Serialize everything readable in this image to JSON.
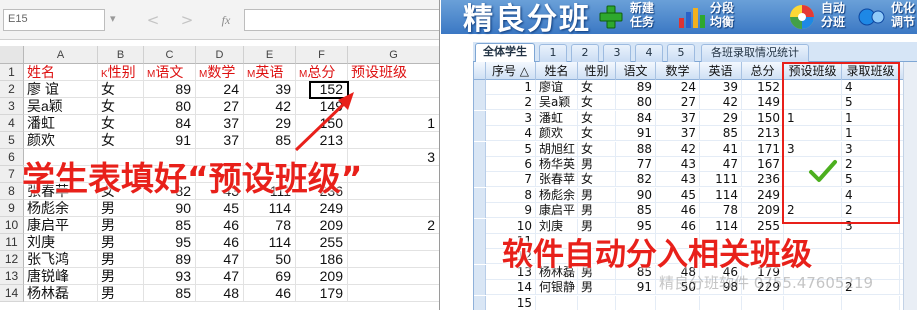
{
  "spreadsheet": {
    "name_box": "E15",
    "fx_label": "fx",
    "nav_left": "<",
    "nav_right": ">",
    "columns": [
      "A",
      "B",
      "C",
      "D",
      "E",
      "F",
      "G"
    ],
    "header_row": {
      "row_no": "1",
      "cells": [
        {
          "marker": "",
          "text": "姓名"
        },
        {
          "marker": "K",
          "text": "性别"
        },
        {
          "marker": "M",
          "text": "语文"
        },
        {
          "marker": "M",
          "text": "数学"
        },
        {
          "marker": "M",
          "text": "英语"
        },
        {
          "marker": "M",
          "text": "总分"
        },
        {
          "marker": "",
          "text": "预设班级"
        }
      ]
    },
    "rows": [
      {
        "no": "2",
        "name": "廖 谊",
        "gender": "女",
        "chinese": "89",
        "math": "24",
        "english": "39",
        "total": "152",
        "preset": ""
      },
      {
        "no": "3",
        "name": "吴a颖",
        "gender": "女",
        "chinese": "80",
        "math": "27",
        "english": "42",
        "total": "149",
        "preset": ""
      },
      {
        "no": "4",
        "name": "潘虹",
        "gender": "女",
        "chinese": "84",
        "math": "37",
        "english": "29",
        "total": "150",
        "preset": "1"
      },
      {
        "no": "5",
        "name": "颜欢",
        "gender": "女",
        "chinese": "91",
        "math": "37",
        "english": "85",
        "total": "213",
        "preset": ""
      },
      {
        "no": "6",
        "name": "",
        "gender": "",
        "chinese": "",
        "math": "",
        "english": "",
        "total": "",
        "preset": "3"
      },
      {
        "no": "7",
        "name": "",
        "gender": "",
        "chinese": "",
        "math": "",
        "english": "",
        "total": "",
        "preset": ""
      },
      {
        "no": "8",
        "name": "张春苹",
        "gender": "女",
        "chinese": "82",
        "math": "43",
        "english": "111",
        "total": "236",
        "preset": ""
      },
      {
        "no": "9",
        "name": "杨彪余",
        "gender": "男",
        "chinese": "90",
        "math": "45",
        "english": "114",
        "total": "249",
        "preset": ""
      },
      {
        "no": "10",
        "name": "康启平",
        "gender": "男",
        "chinese": "85",
        "math": "46",
        "english": "78",
        "total": "209",
        "preset": "2"
      },
      {
        "no": "11",
        "name": "刘庚",
        "gender": "男",
        "chinese": "95",
        "math": "46",
        "english": "114",
        "total": "255",
        "preset": ""
      },
      {
        "no": "12",
        "name": "张飞鸿",
        "gender": "男",
        "chinese": "89",
        "math": "47",
        "english": "50",
        "total": "186",
        "preset": ""
      },
      {
        "no": "13",
        "name": "唐锐峰",
        "gender": "男",
        "chinese": "93",
        "math": "47",
        "english": "69",
        "total": "209",
        "preset": ""
      },
      {
        "no": "14",
        "name": "杨林磊",
        "gender": "男",
        "chinese": "85",
        "math": "48",
        "english": "46",
        "total": "179",
        "preset": ""
      }
    ],
    "callout": "学生表填好“预设班级”"
  },
  "app": {
    "title": "精良分班",
    "toolbar": [
      {
        "icon": "plus-icon",
        "label": "新建\n任务"
      },
      {
        "icon": "bar-chart-icon",
        "label": "分段\n均衡"
      },
      {
        "icon": "color-wheel-icon",
        "label": "自动\n分班"
      },
      {
        "icon": "adjust-icon",
        "label": "优化\n调节"
      }
    ],
    "tabs": [
      "全体学生",
      "1",
      "2",
      "3",
      "4",
      "5",
      "各班录取情况统计"
    ],
    "active_tab": "全体学生",
    "columns": [
      "序号 △",
      "姓名",
      "性别",
      "语文",
      "数学",
      "英语",
      "总分",
      "预设班级",
      "录取班级"
    ],
    "rows": [
      {
        "seq": "1",
        "name": "廖谊",
        "gender": "女",
        "chinese": "89",
        "math": "24",
        "english": "39",
        "total": "152",
        "preset": "",
        "assigned": "4"
      },
      {
        "seq": "2",
        "name": "吴a颖",
        "gender": "女",
        "chinese": "80",
        "math": "27",
        "english": "42",
        "total": "149",
        "preset": "",
        "assigned": "5"
      },
      {
        "seq": "3",
        "name": "潘虹",
        "gender": "女",
        "chinese": "84",
        "math": "37",
        "english": "29",
        "total": "150",
        "preset": "1",
        "assigned": "1"
      },
      {
        "seq": "4",
        "name": "颜欢",
        "gender": "女",
        "chinese": "91",
        "math": "37",
        "english": "85",
        "total": "213",
        "preset": "",
        "assigned": "1"
      },
      {
        "seq": "5",
        "name": "胡旭红",
        "gender": "女",
        "chinese": "88",
        "math": "42",
        "english": "41",
        "total": "171",
        "preset": "3",
        "assigned": "3"
      },
      {
        "seq": "6",
        "name": "杨华英",
        "gender": "男",
        "chinese": "77",
        "math": "43",
        "english": "47",
        "total": "167",
        "preset": "",
        "assigned": "2"
      },
      {
        "seq": "7",
        "name": "张春苹",
        "gender": "女",
        "chinese": "82",
        "math": "43",
        "english": "111",
        "total": "236",
        "preset": "",
        "assigned": "5"
      },
      {
        "seq": "8",
        "name": "杨彪余",
        "gender": "男",
        "chinese": "90",
        "math": "45",
        "english": "114",
        "total": "249",
        "preset": "",
        "assigned": "4"
      },
      {
        "seq": "9",
        "name": "康启平",
        "gender": "男",
        "chinese": "85",
        "math": "46",
        "english": "78",
        "total": "209",
        "preset": "2",
        "assigned": "2"
      },
      {
        "seq": "10",
        "name": "刘庚",
        "gender": "男",
        "chinese": "95",
        "math": "46",
        "english": "114",
        "total": "255",
        "preset": "",
        "assigned": "3"
      },
      {
        "seq": "11",
        "name": "",
        "gender": "",
        "chinese": "",
        "math": "",
        "english": "",
        "total": "",
        "preset": "",
        "assigned": ""
      },
      {
        "seq": "12",
        "name": "",
        "gender": "",
        "chinese": "",
        "math": "",
        "english": "",
        "total": "",
        "preset": "",
        "assigned": ""
      },
      {
        "seq": "13",
        "name": "杨林磊",
        "gender": "男",
        "chinese": "85",
        "math": "48",
        "english": "46",
        "total": "179",
        "preset": "",
        "assigned": ""
      },
      {
        "seq": "14",
        "name": "何银静",
        "gender": "男",
        "chinese": "91",
        "math": "50",
        "english": "98",
        "total": "229",
        "preset": "",
        "assigned": "2"
      },
      {
        "seq": "15",
        "name": "",
        "gender": "",
        "chinese": "",
        "math": "",
        "english": "",
        "total": "",
        "preset": "",
        "assigned": ""
      }
    ],
    "callout": "软件自动分入相关班级",
    "watermark": "精良分班软件 0755.47605219",
    "colors": {
      "accent_red": "#e8201a",
      "header_blue": "#3b78c4",
      "check_green": "#4caf1f"
    }
  }
}
